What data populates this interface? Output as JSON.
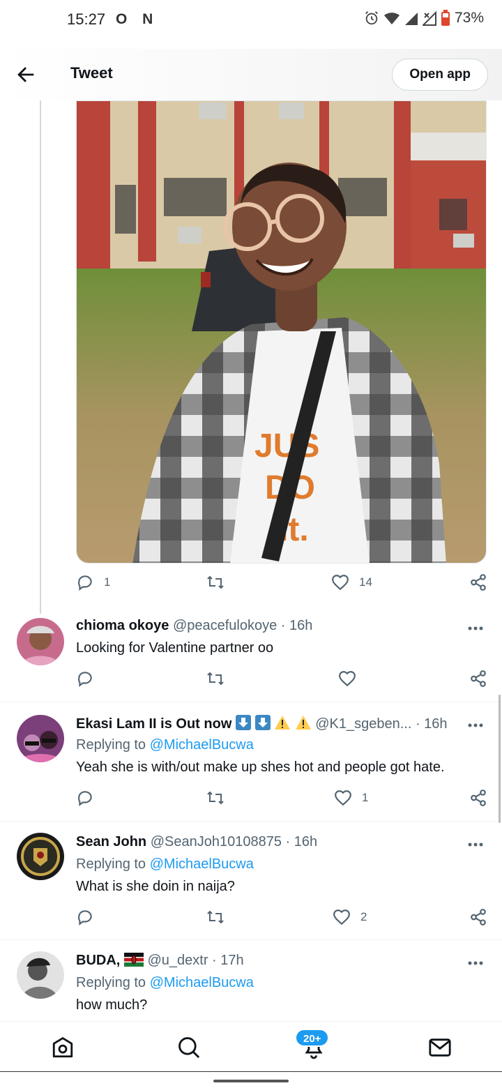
{
  "status_bar": {
    "time": "15:27",
    "left_icons": "O N",
    "battery": "73%"
  },
  "header": {
    "title": "Tweet",
    "open_app_label": "Open app"
  },
  "main_tweet": {
    "reply_count": "1",
    "retweet_count": "",
    "like_count": "14"
  },
  "replies": [
    {
      "name": "chioma okoye",
      "handle": "@peacefulokoye · 16h",
      "replying_prefix": "",
      "replying_to": "",
      "text": "Looking for Valentine partner oo",
      "reply_count": "",
      "retweet_count": "",
      "like_count": ""
    },
    {
      "name": "Ekasi Lam II is Out now",
      "handle": "@K1_sgeben...",
      "time": "· 16h",
      "replying_prefix": "Replying to ",
      "replying_to": "@MichaelBucwa",
      "text": "Yeah she is with/out make up shes hot and people got hate.",
      "reply_count": "",
      "retweet_count": "",
      "like_count": "1"
    },
    {
      "name": "Sean John",
      "handle": "@SeanJoh10108875 · 16h",
      "replying_prefix": "Replying to ",
      "replying_to": "@MichaelBucwa",
      "text": "What is she doin in naija?",
      "reply_count": "",
      "retweet_count": "",
      "like_count": "2"
    },
    {
      "name": "BUDA,",
      "handle": "@u_dextr · 17h",
      "replying_prefix": "Replying to ",
      "replying_to": "@MichaelBucwa",
      "text": "how much?"
    }
  ],
  "bottom_nav": {
    "notification_badge": "20+"
  },
  "icons": {
    "back": "arrow-left-icon",
    "reply": "speech-bubble-icon",
    "retweet": "retweet-icon",
    "like": "heart-icon",
    "share": "share-icon",
    "more": "more-dots-icon",
    "home": "home-icon",
    "search": "search-icon",
    "notifications": "bell-icon",
    "messages": "envelope-icon"
  },
  "colors": {
    "link": "#1d9bf0",
    "secondary_text": "#536471",
    "primary_text": "#0f1419"
  }
}
